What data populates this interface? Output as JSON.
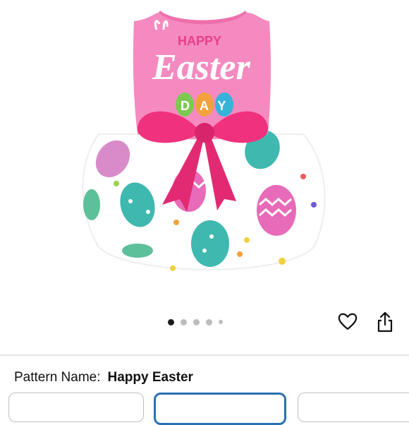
{
  "product_image": {
    "top_print_line1": "HAPPY",
    "top_print_line2": "Easter",
    "top_print_line3": "DAY",
    "colors": {
      "top": "#f58ac0",
      "bow": "#f0327e",
      "skirt": "#ffffff",
      "egg_teal": "#3fb8b0",
      "egg_pink": "#e76bb8"
    }
  },
  "carousel": {
    "total": 5,
    "active_index": 0
  },
  "actions": {
    "favorite_icon": "heart-icon",
    "share_icon": "share-icon"
  },
  "pattern": {
    "label": "Pattern Name:",
    "value": "Happy Easter"
  },
  "options": {
    "selected_index": 1,
    "accent": "#2a6fb0"
  }
}
